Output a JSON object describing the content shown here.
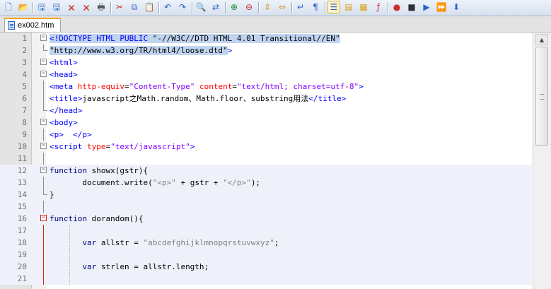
{
  "toolbar": {
    "buttons": [
      {
        "name": "new-file-icon",
        "glyph": "🗋",
        "color": "#2a62c9"
      },
      {
        "name": "open-file-icon",
        "glyph": "📂",
        "color": "#d8a21a"
      },
      {
        "name": "save-icon",
        "glyph": "🖫",
        "color": "#2a62c9"
      },
      {
        "name": "save-all-icon",
        "glyph": "🖫",
        "color": "#2a62c9"
      },
      {
        "name": "close-icon",
        "glyph": "🗙",
        "color": "#c9302c"
      },
      {
        "name": "close-all-icon",
        "glyph": "🗙",
        "color": "#c9302c"
      },
      {
        "name": "print-icon",
        "glyph": "🖶",
        "color": "#555555"
      },
      {
        "name": "cut-icon",
        "glyph": "✂",
        "color": "#c9302c"
      },
      {
        "name": "copy-icon",
        "glyph": "⧉",
        "color": "#2a62c9"
      },
      {
        "name": "paste-icon",
        "glyph": "📋",
        "color": "#b07a2a"
      },
      {
        "name": "undo-icon",
        "glyph": "↶",
        "color": "#2a62c9"
      },
      {
        "name": "redo-icon",
        "glyph": "↷",
        "color": "#2a62c9"
      },
      {
        "name": "find-icon",
        "glyph": "🔍",
        "color": "#333333"
      },
      {
        "name": "replace-icon",
        "glyph": "⇄",
        "color": "#2a62c9"
      },
      {
        "name": "zoom-in-icon",
        "glyph": "⊕",
        "color": "#1a8a2a"
      },
      {
        "name": "zoom-out-icon",
        "glyph": "⊖",
        "color": "#c9302c"
      },
      {
        "name": "sync-vertical-icon",
        "glyph": "⇕",
        "color": "#d8a21a"
      },
      {
        "name": "sync-horizontal-icon",
        "glyph": "⇔",
        "color": "#d8a21a"
      },
      {
        "name": "word-wrap-icon",
        "glyph": "↵",
        "color": "#2a62c9"
      },
      {
        "name": "show-all-chars-icon",
        "glyph": "¶",
        "color": "#2a62c9"
      },
      {
        "name": "indent-guide-icon",
        "glyph": "☰",
        "color": "#2a62c9",
        "active": true
      },
      {
        "name": "user-language-icon",
        "glyph": "▤",
        "color": "#d8a21a"
      },
      {
        "name": "doc-map-icon",
        "glyph": "▦",
        "color": "#d8a21a"
      },
      {
        "name": "function-list-icon",
        "glyph": "ƒ",
        "color": "#c9302c"
      },
      {
        "name": "record-macro-icon",
        "glyph": "●",
        "color": "#c9302c"
      },
      {
        "name": "stop-macro-icon",
        "glyph": "■",
        "color": "#333333"
      },
      {
        "name": "play-macro-icon",
        "glyph": "▶",
        "color": "#2a62c9"
      },
      {
        "name": "play-macro-multiple-icon",
        "glyph": "⏩",
        "color": "#2a62c9"
      },
      {
        "name": "save-macro-icon",
        "glyph": "⬇",
        "color": "#2a62c9"
      }
    ]
  },
  "tab": {
    "label": "ex002.htm"
  },
  "editor": {
    "lines": [
      {
        "num": "1",
        "tokens": [
          {
            "t": "<!DOCTYPE HTML PUBLIC ",
            "c": "c-tag c-sel"
          },
          {
            "t": "\"-//W3C//DTD HTML 4.01 Transitional//EN\"",
            "c": "c-text c-sel"
          }
        ]
      },
      {
        "num": "2",
        "tokens": [
          {
            "t": "\"http://www.w3.org/TR/html4/loose.dtd\"",
            "c": "c-text c-sel"
          },
          {
            "t": ">",
            "c": "c-tag"
          }
        ]
      },
      {
        "num": "3",
        "tokens": [
          {
            "t": "<html>",
            "c": "c-tag"
          }
        ]
      },
      {
        "num": "4",
        "tokens": [
          {
            "t": "<head>",
            "c": "c-tag"
          }
        ]
      },
      {
        "num": "5",
        "tokens": [
          {
            "t": "<meta ",
            "c": "c-tag"
          },
          {
            "t": "http-equiv",
            "c": "c-attr"
          },
          {
            "t": "=",
            "c": "c-text"
          },
          {
            "t": "\"Content-Type\"",
            "c": "c-str"
          },
          {
            "t": " ",
            "c": "c-text"
          },
          {
            "t": "content",
            "c": "c-attr"
          },
          {
            "t": "=",
            "c": "c-text"
          },
          {
            "t": "\"text/html; charset=utf-8\"",
            "c": "c-str"
          },
          {
            "t": ">",
            "c": "c-tag"
          }
        ]
      },
      {
        "num": "6",
        "tokens": [
          {
            "t": "<title>",
            "c": "c-tag"
          },
          {
            "t": "javascript之Math.random、Math.floor、substring用法",
            "c": "c-text"
          },
          {
            "t": "</title>",
            "c": "c-tag"
          }
        ]
      },
      {
        "num": "7",
        "tokens": [
          {
            "t": "</head>",
            "c": "c-tag"
          }
        ]
      },
      {
        "num": "8",
        "tokens": [
          {
            "t": "<body>",
            "c": "c-tag"
          }
        ]
      },
      {
        "num": "9",
        "tokens": [
          {
            "t": "<p>",
            "c": "c-tag"
          },
          {
            "t": "  ",
            "c": "c-text"
          },
          {
            "t": "</p>",
            "c": "c-tag"
          }
        ]
      },
      {
        "num": "10",
        "tokens": [
          {
            "t": "<script ",
            "c": "c-tag"
          },
          {
            "t": "type",
            "c": "c-attr"
          },
          {
            "t": "=",
            "c": "c-text"
          },
          {
            "t": "\"text/javascript\"",
            "c": "c-str"
          },
          {
            "t": ">",
            "c": "c-tag"
          }
        ]
      },
      {
        "num": "11",
        "tokens": []
      },
      {
        "num": "12",
        "tokens": [
          {
            "t": "function",
            "c": "c-kw"
          },
          {
            "t": " showx(gstr){",
            "c": "c-text"
          }
        ]
      },
      {
        "num": "13",
        "tokens": [
          {
            "t": "       document.write(",
            "c": "c-text"
          },
          {
            "t": "\"<p>\"",
            "c": "c-jsstr"
          },
          {
            "t": " + gstr + ",
            "c": "c-text"
          },
          {
            "t": "\"</p>\"",
            "c": "c-jsstr"
          },
          {
            "t": ");",
            "c": "c-text"
          }
        ]
      },
      {
        "num": "14",
        "tokens": [
          {
            "t": "}",
            "c": "c-text"
          }
        ]
      },
      {
        "num": "15",
        "tokens": []
      },
      {
        "num": "16",
        "tokens": [
          {
            "t": "function",
            "c": "c-kw"
          },
          {
            "t": " dorandom(){",
            "c": "c-text"
          }
        ]
      },
      {
        "num": "17",
        "tokens": []
      },
      {
        "num": "18",
        "tokens": [
          {
            "t": "       ",
            "c": "c-text"
          },
          {
            "t": "var",
            "c": "c-kw"
          },
          {
            "t": " allstr = ",
            "c": "c-text"
          },
          {
            "t": "\"abcdefghijklmnopqrstuvwxyz\"",
            "c": "c-jsstr"
          },
          {
            "t": ";",
            "c": "c-text"
          }
        ]
      },
      {
        "num": "19",
        "tokens": []
      },
      {
        "num": "20",
        "tokens": [
          {
            "t": "       ",
            "c": "c-text"
          },
          {
            "t": "var",
            "c": "c-kw"
          },
          {
            "t": " strlen = allstr.length;",
            "c": "c-text"
          }
        ]
      },
      {
        "num": "21",
        "tokens": []
      }
    ]
  }
}
